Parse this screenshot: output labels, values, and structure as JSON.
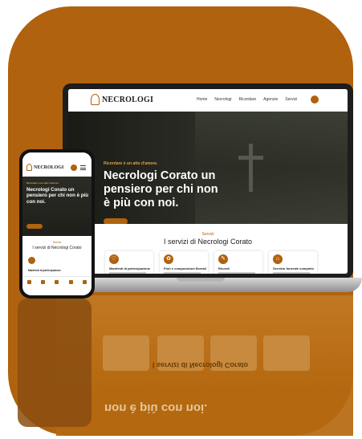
{
  "colors": {
    "accent": "#b0620f",
    "dark_text": "#1c1c1c",
    "hero_bg": "#24251f"
  },
  "laptop": {
    "nav": {
      "brand": "NECROLOGI",
      "links": [
        "Home",
        "Necrologi",
        "Ricordare",
        "Agenzie",
        "Servizi"
      ],
      "search_icon": "search-icon"
    },
    "hero": {
      "pretitle": "Ricordare è un atto d'amore.",
      "title": "Necrologi Corato un pensiero per chi non è più con noi."
    },
    "services": {
      "small_label": "Servizi",
      "title": "I servizi di Necrologi Corato",
      "cards": [
        {
          "icon": "heart-icon",
          "title": "Manifesti di partecipazione"
        },
        {
          "icon": "flower-icon",
          "title": "Fiori e composizioni floreali"
        },
        {
          "icon": "pen-icon",
          "title": "Ricordi"
        },
        {
          "icon": "home-icon",
          "title": "Servizio funerale completo"
        }
      ]
    }
  },
  "phone": {
    "nav": {
      "brand": "NECROLOGI"
    },
    "hero": {
      "pretitle": "Ricordare è un atto d'amore.",
      "title": "Necrologi Corato un pensiero per chi non è più con noi."
    },
    "services": {
      "small_label": "Servizi",
      "title": "I servizi di Necrologi Corato",
      "first_card_title": "Manifesti di partecipazione"
    }
  },
  "reflection": {
    "services_title": "I servizi di Necrologi Corato",
    "hero_title": "non è più con noi."
  }
}
